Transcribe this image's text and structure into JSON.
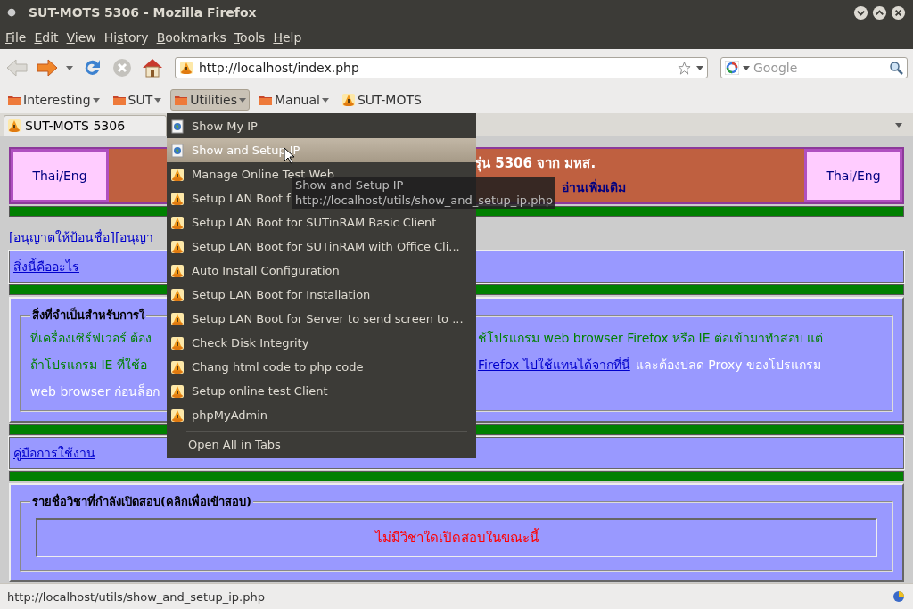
{
  "window": {
    "title": "SUT-MOTS 5306 - Mozilla Firefox"
  },
  "menubar": [
    {
      "key": "F",
      "post": "ile"
    },
    {
      "key": "E",
      "post": "dit"
    },
    {
      "key": "V",
      "post": "iew"
    },
    {
      "pre": "Hi",
      "key": "s",
      "post": "tory"
    },
    {
      "key": "B",
      "post": "ookmarks"
    },
    {
      "key": "T",
      "post": "ools"
    },
    {
      "key": "H",
      "post": "elp"
    }
  ],
  "toolbar": {
    "url": "http://localhost/index.php",
    "search_placeholder": "Google"
  },
  "bookmarks": [
    {
      "label": "Interesting",
      "kind": "folder",
      "selected": false
    },
    {
      "label": "SUT",
      "kind": "folder",
      "selected": false
    },
    {
      "label": "Utilities",
      "kind": "folder",
      "selected": true
    },
    {
      "label": "Manual",
      "kind": "folder",
      "selected": false
    },
    {
      "label": "SUT-MOTS",
      "kind": "site",
      "selected": false
    }
  ],
  "tab": {
    "title": "SUT-MOTS 5306"
  },
  "page": {
    "header": {
      "lang_left": "Thai/Eng",
      "banner_text": "รุ่น 5306 จาก มหส.",
      "banner_link": "อ่านเพิ่มเติม",
      "lang_right": "Thai/Eng"
    },
    "permissions_link": "[อนุญาตให้ป้อนชื่อ][อนุญา",
    "what_link": "สิ่งนี้คืออะไร",
    "requirements": {
      "legend": "สิ่งที่จำเป็นสำหรับการใ",
      "lines": [
        {
          "left": "ที่เครื่องเซิร์ฟเวอร์ ต้อง",
          "right": "ช้โปรแกรม web browser Firefox หรือ IE ต่อเข้ามาทำสอบ แต่"
        },
        {
          "left": "ถ้าโปรแกรม IE ที่ใช้อ",
          "right_link": "Firefox ไปใช้แทนได้จากที่นี่",
          "right": "และต้องปลด Proxy ของโปรแกรม"
        },
        {
          "left": "web browser ก่อนล็อก"
        }
      ]
    },
    "manual_link": "คู่มือการใช้งาน",
    "courses": {
      "legend": "รายชื่อวิชาที่กำลังเปิดสอบ(คลิกเพื่อเข้าสอบ)",
      "empty": "ไม่มีวิชาใดเปิดสอบในขณะนี้"
    }
  },
  "menu": {
    "items": [
      {
        "label": "Show My IP",
        "kind": "page",
        "selected": false
      },
      {
        "label": "Show and Setup IP",
        "kind": "page",
        "selected": true
      },
      {
        "label": "Manage Online Test Web",
        "kind": "site",
        "selected": false
      },
      {
        "label": "Setup LAN Boot f",
        "kind": "site",
        "selected": false
      },
      {
        "label": "Setup LAN Boot for SUTinRAM Basic Client",
        "kind": "site",
        "selected": false
      },
      {
        "label": "Setup LAN Boot for SUTinRAM with Office Cli...",
        "kind": "site",
        "selected": false
      },
      {
        "label": "Auto Install Configuration",
        "kind": "site",
        "selected": false
      },
      {
        "label": "Setup LAN Boot for Installation",
        "kind": "site",
        "selected": false
      },
      {
        "label": "Setup LAN Boot for Server to send screen to ...",
        "kind": "site",
        "selected": false
      },
      {
        "label": "Check Disk Integrity",
        "kind": "site",
        "selected": false
      },
      {
        "label": "Chang html code to php code",
        "kind": "site",
        "selected": false
      },
      {
        "label": "Setup online test Client",
        "kind": "site",
        "selected": false
      },
      {
        "label": "phpMyAdmin",
        "kind": "site",
        "selected": false
      }
    ],
    "footer": "Open All in Tabs"
  },
  "tooltip": {
    "title": "Show and Setup IP",
    "url": "http://localhost/utils/show_and_setup_ip.php"
  },
  "status_bar": {
    "text": "http://localhost/utils/show_and_setup_ip.php"
  }
}
